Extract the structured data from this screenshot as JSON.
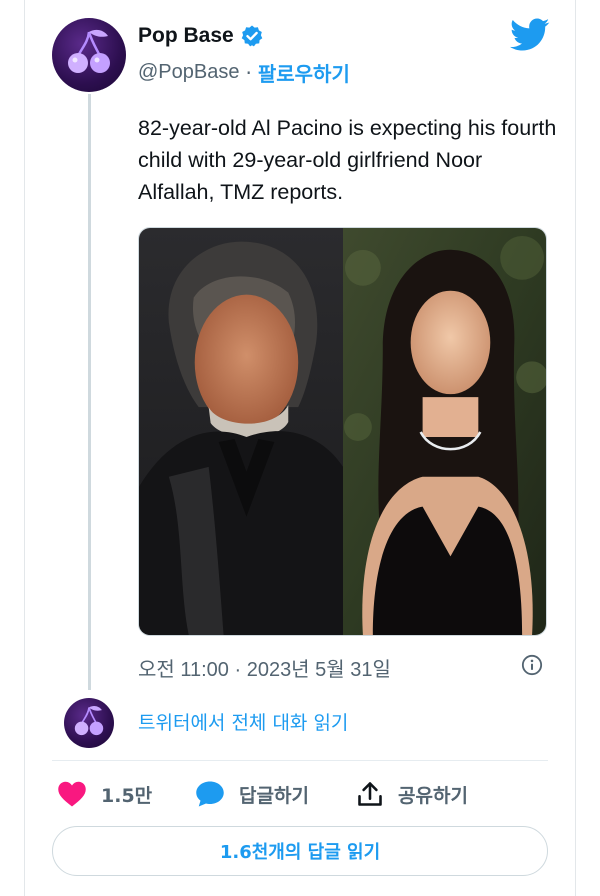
{
  "author": {
    "display_name": "Pop Base",
    "handle": "@PopBase",
    "separator": "·",
    "follow_label": "팔로우하기",
    "verified": true,
    "avatar_icon": "cherry-logo"
  },
  "tweet": {
    "text": "82-year-old Al Pacino is expecting his fourth child with 29-year-old girlfriend Noor Alfallah, TMZ reports.",
    "timestamp": "오전 11:00 · 2023년 5월 31일",
    "media": [
      "photo-man-dark-suit",
      "photo-woman-black-dress"
    ]
  },
  "conversation": {
    "link_label": "트위터에서 전체 대화 읽기"
  },
  "actions": {
    "like_count": "1.5만",
    "reply_label": "답글하기",
    "share_label": "공유하기"
  },
  "footer": {
    "read_replies_label": "1.6천개의 답글 읽기"
  },
  "colors": {
    "accent": "#1d9bf0",
    "like": "#f91880",
    "muted": "#536471"
  }
}
